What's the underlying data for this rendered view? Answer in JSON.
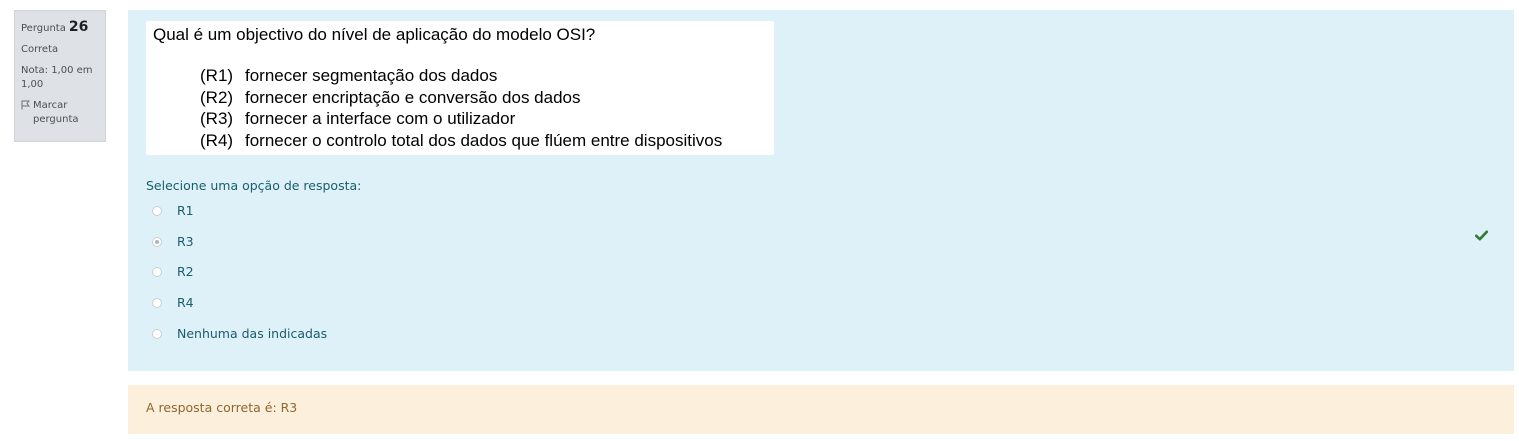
{
  "info": {
    "question_label": "Pergunta",
    "question_number": "26",
    "state": "Correta",
    "grade": "Nota: 1,00 em 1,00",
    "flag_label": "Marcar pergunta"
  },
  "question": {
    "title": "Qual é um objectivo do nível de aplicação do modelo OSI?",
    "items": [
      {
        "code": "(R1)",
        "text": "fornecer segmentação dos dados"
      },
      {
        "code": "(R2)",
        "text": "fornecer encriptação e conversão dos dados"
      },
      {
        "code": "(R3)",
        "text": "fornecer a interface com o utilizador"
      },
      {
        "code": "(R4)",
        "text": "fornecer o controlo total dos dados que flúem entre dispositivos"
      }
    ],
    "prompt": "Selecione uma opção de resposta:",
    "options": [
      {
        "label": "R1",
        "selected": false
      },
      {
        "label": "R3",
        "selected": true
      },
      {
        "label": "R2",
        "selected": false
      },
      {
        "label": "R4",
        "selected": false
      },
      {
        "label": "Nenhuma das indicadas",
        "selected": false
      }
    ],
    "correct_icon": "check-icon"
  },
  "feedback": {
    "right_answer": "A resposta correta é: R3"
  },
  "colors": {
    "content_bg": "#def1f8",
    "info_bg": "#dee2e6",
    "feedback_bg": "#fcefdc",
    "correct": "#357a32"
  }
}
